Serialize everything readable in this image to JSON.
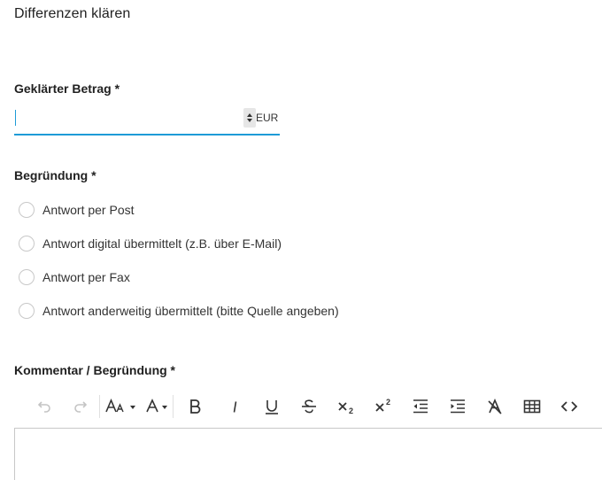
{
  "page": {
    "title": "Differenzen klären"
  },
  "amount": {
    "label": "Geklärter Betrag *",
    "value": "",
    "currency": "EUR"
  },
  "reason": {
    "label": "Begründung *",
    "options": [
      {
        "label": "Antwort per Post",
        "selected": false
      },
      {
        "label": "Antwort digital übermittelt (z.B. über E-Mail)",
        "selected": false
      },
      {
        "label": "Antwort per Fax",
        "selected": false
      },
      {
        "label": "Antwort anderweitig übermittelt (bitte Quelle angeben)",
        "selected": false
      }
    ]
  },
  "comment": {
    "label": "Kommentar / Begründung *",
    "value": ""
  },
  "toolbar": {
    "items": [
      {
        "name": "undo-icon",
        "enabled": false
      },
      {
        "name": "redo-icon",
        "enabled": false
      },
      {
        "name": "font-size-icon",
        "enabled": true
      },
      {
        "name": "font-color-icon",
        "enabled": true
      },
      {
        "name": "bold-icon",
        "enabled": true
      },
      {
        "name": "italic-icon",
        "enabled": true
      },
      {
        "name": "underline-icon",
        "enabled": true
      },
      {
        "name": "strikethrough-icon",
        "enabled": true
      },
      {
        "name": "subscript-icon",
        "enabled": true
      },
      {
        "name": "superscript-icon",
        "enabled": true
      },
      {
        "name": "outdent-icon",
        "enabled": true
      },
      {
        "name": "indent-icon",
        "enabled": true
      },
      {
        "name": "clear-formatting-icon",
        "enabled": true
      },
      {
        "name": "table-icon",
        "enabled": true
      },
      {
        "name": "source-code-icon",
        "enabled": true
      }
    ],
    "accent_color": "#1e9bd7"
  }
}
